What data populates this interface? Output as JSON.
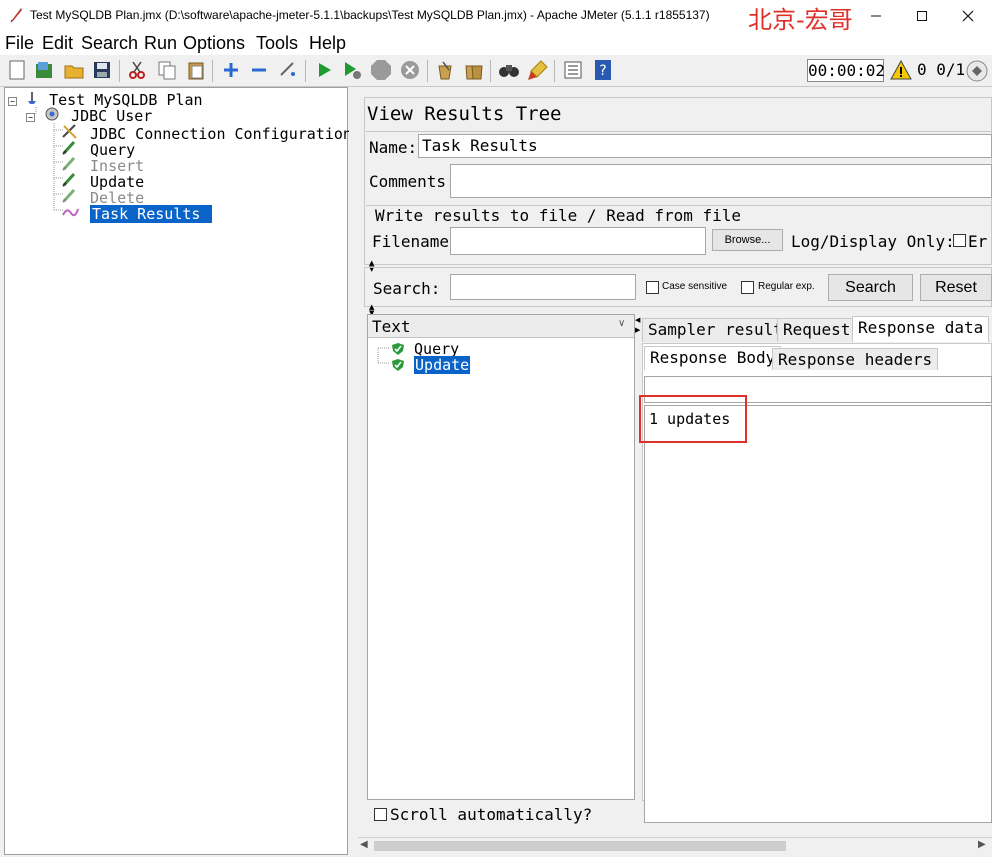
{
  "window": {
    "title": "Test MySQLDB Plan.jmx (D:\\software\\apache-jmeter-5.1.1\\backups\\Test MySQLDB Plan.jmx) - Apache JMeter (5.1.1 r1855137)",
    "watermark": "北京-宏哥",
    "controls": {
      "minimize": "—",
      "maximize": "☐",
      "close": "✕"
    }
  },
  "menu": [
    "File",
    "Edit",
    "Search",
    "Run",
    "Options",
    "Tools",
    "Help"
  ],
  "toolbar": {
    "icons": [
      "new-icon",
      "templates-icon",
      "open-icon",
      "save-icon",
      "cut-icon",
      "copy-icon",
      "paste-icon",
      "expand-icon",
      "collapse-icon",
      "toggle-icon",
      "start-icon",
      "start-no-pause-icon",
      "stop-icon",
      "shutdown-icon",
      "clear-icon",
      "clear-all-icon",
      "search-icon",
      "reset-search-icon",
      "function-helper-icon",
      "help-icon"
    ],
    "timer": "00:00:02",
    "warning_count": "0",
    "threads": "0/1"
  },
  "tree": {
    "items": [
      {
        "label": "Test MySQLDB Plan",
        "icon": "test-plan-icon",
        "level": 0,
        "disabled": false
      },
      {
        "label": "JDBC User",
        "icon": "thread-group-icon",
        "level": 1,
        "disabled": false
      },
      {
        "label": "JDBC Connection Configuration",
        "icon": "config-icon",
        "level": 2,
        "disabled": false
      },
      {
        "label": "Query",
        "icon": "sampler-icon",
        "level": 2,
        "disabled": false
      },
      {
        "label": "Insert",
        "icon": "sampler-icon",
        "level": 2,
        "disabled": true
      },
      {
        "label": "Update",
        "icon": "sampler-icon",
        "level": 2,
        "disabled": false
      },
      {
        "label": "Delete",
        "icon": "sampler-icon",
        "level": 2,
        "disabled": true
      },
      {
        "label": "Task Results",
        "icon": "listener-icon",
        "level": 2,
        "disabled": false,
        "selected": true
      }
    ]
  },
  "panel": {
    "title": "View Results Tree",
    "name_label": "Name:",
    "name_value": "Task Results",
    "comments_label": "Comments:",
    "comments_value": "",
    "file_section_title": "Write results to file / Read from file",
    "filename_label": "Filename",
    "filename_value": "",
    "browse_label": "Browse...",
    "log_display_label": "Log/Display Only:",
    "errors_label": "Er"
  },
  "search": {
    "label": "Search:",
    "value": "",
    "case_sensitive_label": "Case sensitive",
    "regex_label": "Regular exp.",
    "search_button": "Search",
    "reset_button": "Reset"
  },
  "results": {
    "renderer": "Text",
    "samples": [
      {
        "label": "Query",
        "status": "success",
        "selected": false
      },
      {
        "label": "Update",
        "status": "success",
        "selected": true
      }
    ],
    "scroll_label": "Scroll automatically?"
  },
  "tabs": {
    "top": [
      {
        "label": "Sampler result",
        "active": false
      },
      {
        "label": "Request",
        "active": false
      },
      {
        "label": "Response data",
        "active": true
      }
    ],
    "sub": [
      {
        "label": "Response Body",
        "active": true
      },
      {
        "label": "Response headers",
        "active": false
      }
    ]
  },
  "response": {
    "body": "1 updates",
    "highlight_color": "#e0302a"
  },
  "colors": {
    "selection": "#0a64c8",
    "success": "#2c9a3a",
    "watermark": "#e0302a"
  }
}
